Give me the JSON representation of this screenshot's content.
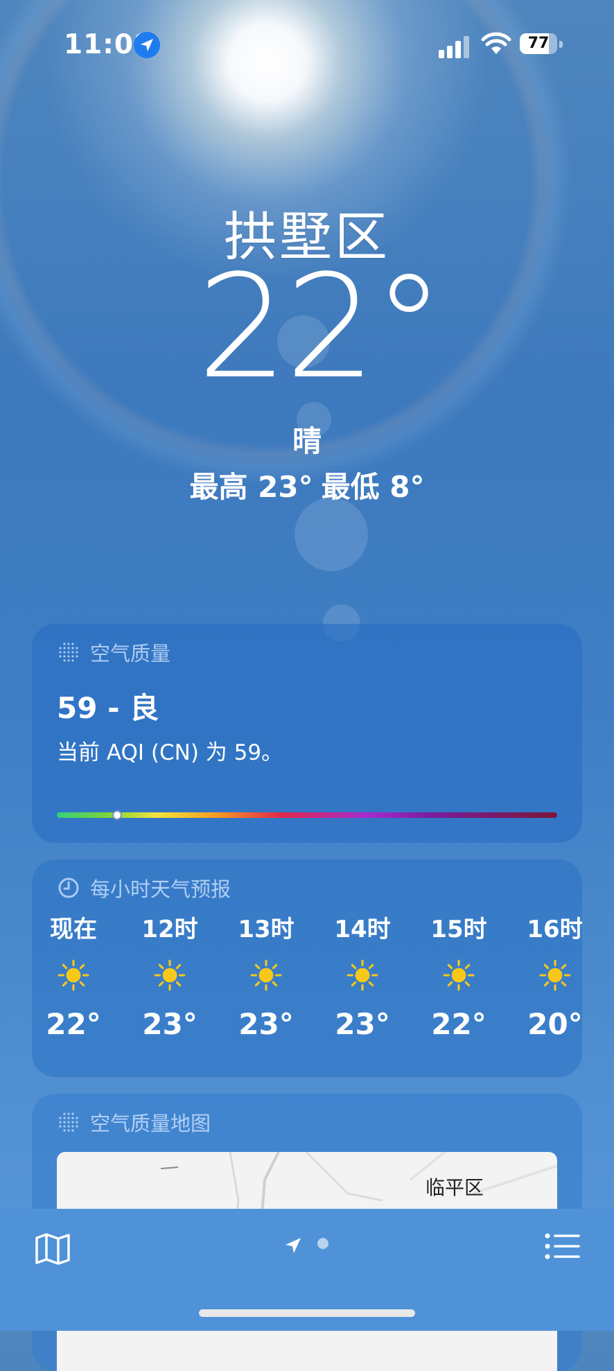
{
  "status_bar": {
    "time": "11:08",
    "battery": "77",
    "battery_level": 0.77
  },
  "header": {
    "city": "拱墅区",
    "temperature": "22°",
    "condition": "晴",
    "high": "最高 23°",
    "low": "最低 8°"
  },
  "air_quality": {
    "title": "空气质量",
    "value": "59 - 良",
    "description": "当前 AQI (CN) 为 59。",
    "scale_position": 0.12
  },
  "hourly": {
    "title": "每小时天气预报",
    "items": [
      {
        "label": "现在",
        "icon": "sun-icon",
        "temp": "22°"
      },
      {
        "label": "12时",
        "icon": "sun-icon",
        "temp": "23°"
      },
      {
        "label": "13时",
        "icon": "sun-icon",
        "temp": "23°"
      },
      {
        "label": "14时",
        "icon": "sun-icon",
        "temp": "23°"
      },
      {
        "label": "15时",
        "icon": "sun-icon",
        "temp": "22°"
      },
      {
        "label": "16时",
        "icon": "sun-icon",
        "temp": "20°"
      }
    ]
  },
  "aqi_map": {
    "title": "空气质量地图",
    "district": "临平区"
  },
  "toolbar": {
    "map_icon": "map-icon",
    "location_icon": "location-arrow-icon",
    "list_icon": "list-icon"
  },
  "colors": {
    "sun": "#f7c81a",
    "location_badge": "#1e7cf0"
  }
}
